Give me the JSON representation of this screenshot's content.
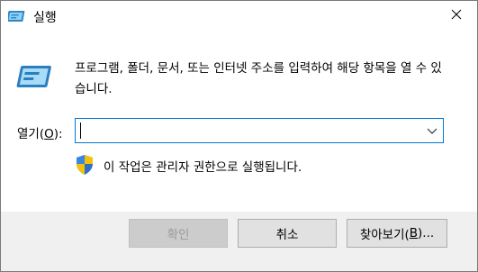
{
  "window": {
    "title": "실행"
  },
  "content": {
    "description": "프로그램, 폴더, 문서, 또는 인터넷 주소를 입력하여 해당 항목을 열 수 있습니다.",
    "open_label": "열기(O):",
    "open_label_prefix": "열기(",
    "open_label_hotkey": "O",
    "open_label_suffix": "):",
    "input_value": "",
    "admin_note": "이 작업은 관리자 권한으로 실행됩니다."
  },
  "footer": {
    "ok_label": "확인",
    "cancel_label": "취소",
    "browse_label": "찾아보기(B)...",
    "browse_prefix": "찾아보기(",
    "browse_hotkey": "B",
    "browse_suffix": ")..."
  },
  "icons": {
    "title": "run-app-icon",
    "big": "run-app-icon",
    "close": "close-icon",
    "dropdown": "chevron-down-icon",
    "uac": "uac-shield-icon"
  },
  "colors": {
    "input_border": "#0078d7",
    "footer_bg": "#f0f0f0",
    "button_bg": "#e1e1e1",
    "button_disabled_bg": "#cccccc"
  }
}
